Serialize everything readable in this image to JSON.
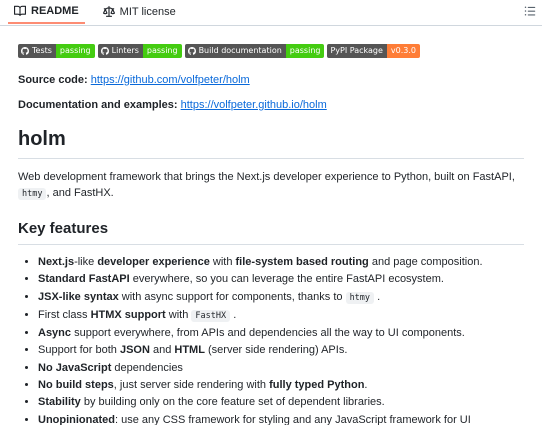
{
  "tabs": [
    {
      "label": "README",
      "icon": "book-icon",
      "active": true
    },
    {
      "label": "MIT license",
      "icon": "scale-icon",
      "active": false
    }
  ],
  "badges": [
    {
      "label": "Tests",
      "status": "passing",
      "color": "#4c1"
    },
    {
      "label": "Linters",
      "status": "passing",
      "color": "#4c1"
    },
    {
      "label": "Build documentation",
      "status": "passing",
      "color": "#4c1"
    },
    {
      "label": "PyPI Package",
      "status": "v0.3.0",
      "color": "#fe7d37"
    }
  ],
  "source_code": {
    "label": "Source code:",
    "url": "https://github.com/volfpeter/holm"
  },
  "docs": {
    "label": "Documentation and examples:",
    "url": "https://volfpeter.github.io/holm"
  },
  "title": "holm",
  "description": {
    "part1": "Web development framework that brings the Next.js developer experience to Python, built on FastAPI, ",
    "code": "htmy",
    "part2": ", and FastHX."
  },
  "features_heading": "Key features",
  "features": [
    {
      "bold1": "Next.js",
      "t1": "-like ",
      "bold2": "developer experience",
      "t2": " with ",
      "bold3": "file-system based routing",
      "t3": " and page composition."
    },
    {
      "bold1": "Standard FastAPI",
      "t1": " everywhere, so you can leverage the entire FastAPI ecosystem."
    },
    {
      "bold1": "JSX-like syntax",
      "t1": " with async support for components, thanks to ",
      "code": "htmy",
      "t2": "."
    },
    {
      "t0": "First class ",
      "bold1": "HTMX support",
      "t1": " with ",
      "code": "FastHX",
      "t2": "."
    },
    {
      "bold1": "Async",
      "t1": " support everywhere, from APIs and dependencies all the way to UI components."
    },
    {
      "t0": "Support for both ",
      "bold1": "JSON",
      "t1": " and ",
      "bold2": "HTML",
      "t2": " (server side rendering) APIs."
    },
    {
      "bold1": "No JavaScript",
      "t1": " dependencies"
    },
    {
      "bold1": "No build steps",
      "t1": ", just server side rendering with ",
      "bold2": "fully typed Python",
      "t2": "."
    },
    {
      "bold1": "Stability",
      "t1": " by building only on the core feature set of dependent libraries."
    },
    {
      "bold1": "Unopinionated",
      "t1": ": use any CSS framework for styling and any JavaScript framework for UI interactivity."
    }
  ]
}
